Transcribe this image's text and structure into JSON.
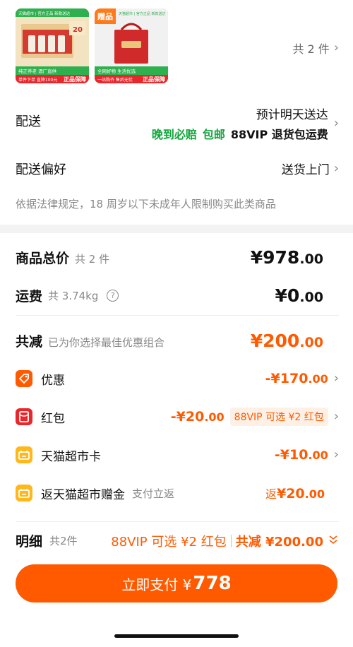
{
  "items": {
    "count_text": "共 2 件",
    "product1": {
      "store_text": "天猫超市 | 官方正品 新款送达",
      "tag_text": "纯正养老 酒厂直供",
      "promo_text": "单件下单 直降100元",
      "badge_text": "正品保障",
      "box_number": "20"
    },
    "product2": {
      "gift_tag": "赠品",
      "store_text": "天猫超市 | 官方正品 新款送达",
      "tag_text": "全网好物 生活优选",
      "promo_text": "一站购齐 售后无忧",
      "badge_text": "正品保障"
    }
  },
  "delivery": {
    "label": "配送",
    "eta": "预计明天送达",
    "late_pay": "晚到必赔",
    "free_ship": "包邮",
    "vip_return": "88VIP 退货包运费"
  },
  "delivery_pref": {
    "label": "配送偏好",
    "value": "送货上门"
  },
  "legal_notice": "依据法律规定，18 周岁以下未成年人限制购买此类商品",
  "summary": {
    "goods_total": {
      "label": "商品总价",
      "note": "共 2 件",
      "currency": "¥",
      "int": "978",
      "dec": ".00"
    },
    "shipping": {
      "label": "运费",
      "note": "共 3.74kg",
      "help": "?",
      "currency": "¥",
      "int": "0",
      "dec": ".00"
    },
    "total_discount": {
      "label": "共减",
      "note": "已为你选择最佳优惠组合",
      "currency": "¥",
      "int": "200",
      "dec": ".00"
    }
  },
  "discounts": [
    {
      "label": "优惠",
      "amount_int": "-¥170",
      "amount_dec": ".00",
      "color": "#ff5a00"
    },
    {
      "label": "红包",
      "amount_int": "-¥20",
      "amount_dec": ".00",
      "chip": "88VIP 可选 ¥2 红包",
      "color": "#e8262c"
    },
    {
      "label": "天猫超市卡",
      "amount_int": "-¥10",
      "amount_dec": ".00",
      "color": "#ffb81c"
    },
    {
      "label": "返天猫超市赠金",
      "sub": "支付立返",
      "prefix": "返",
      "amount_int": "¥20",
      "amount_dec": ".00",
      "color": "#ffb81c"
    }
  ],
  "detail": {
    "label": "明细",
    "note": "共2件",
    "vip_text": "88VIP 可选 ¥2 红包",
    "total_text": "共减 ¥200.00"
  },
  "pay_button": {
    "label": "立即支付 ¥",
    "amount": "778"
  },
  "colors": {
    "accent_orange": "#ff5a00",
    "green": "#12a53c"
  }
}
